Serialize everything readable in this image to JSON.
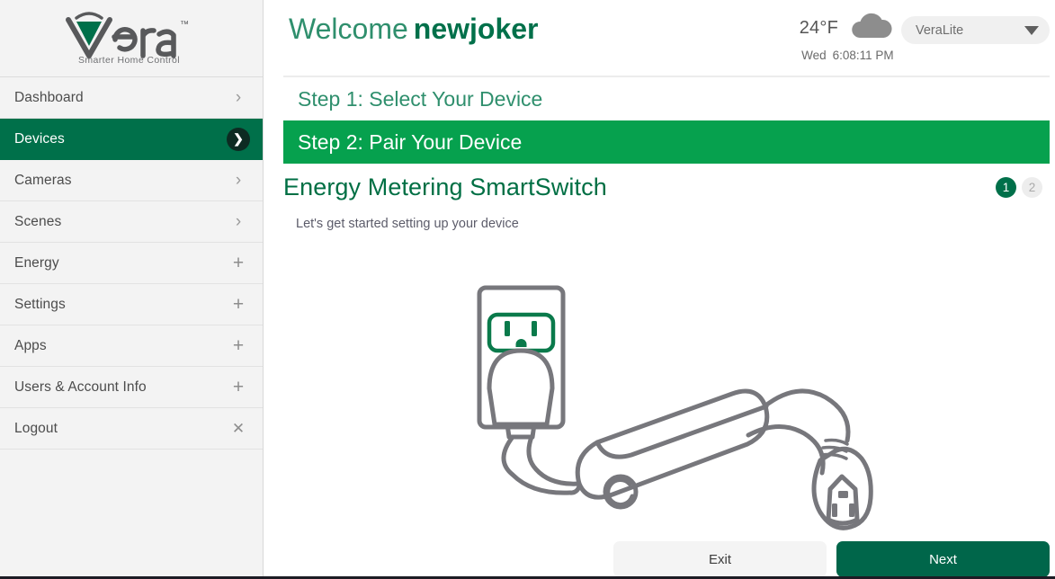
{
  "brand": {
    "name": "vera",
    "trademark": "™",
    "tagline": "Smarter Home Control",
    "logo_green": "#00704a",
    "logo_gray": "#58595b"
  },
  "sidebar": {
    "items": [
      {
        "label": "Dashboard",
        "icon": "chevron-right-icon",
        "active": false
      },
      {
        "label": "Devices",
        "icon": "chevron-right-circle-icon",
        "active": true
      },
      {
        "label": "Cameras",
        "icon": "chevron-right-icon",
        "active": false
      },
      {
        "label": "Scenes",
        "icon": "chevron-right-icon",
        "active": false
      },
      {
        "label": "Energy",
        "icon": "plus-icon",
        "active": false
      },
      {
        "label": "Settings",
        "icon": "plus-icon",
        "active": false
      },
      {
        "label": "Apps",
        "icon": "plus-icon",
        "active": false
      },
      {
        "label": "Users & Account Info",
        "icon": "plus-icon",
        "active": false
      },
      {
        "label": "Logout",
        "icon": "close-icon",
        "active": false
      }
    ]
  },
  "header": {
    "welcome_prefix": "Welcome",
    "username": "newjoker",
    "weather": {
      "temperature": "24°F",
      "icon": "cloud-icon",
      "day": "Wed",
      "time": "6:08:11 PM"
    },
    "unit_selector": {
      "value": "VeraLite",
      "icon": "chevron-down-icon"
    }
  },
  "steps": [
    {
      "label": "Step 1: Select Your Device",
      "active": false
    },
    {
      "label": "Step 2: Pair Your Device",
      "active": true
    }
  ],
  "wizard": {
    "device_title": "Energy Metering SmartSwitch",
    "pager": [
      {
        "label": "1",
        "active": true
      },
      {
        "label": "2",
        "active": false
      }
    ],
    "instruction": "Let's get started setting up your device",
    "illustration": "wall-outlet-smartswitch-illustration"
  },
  "footer": {
    "exit_label": "Exit",
    "next_label": "Next"
  },
  "colors": {
    "sidebar_active_green": "#00704a",
    "step_active_green": "#06a14e",
    "title_green": "#006f44",
    "primary_button_green": "#00664a",
    "outlet_green": "#0a7a4b",
    "line_gray": "#77777c"
  }
}
